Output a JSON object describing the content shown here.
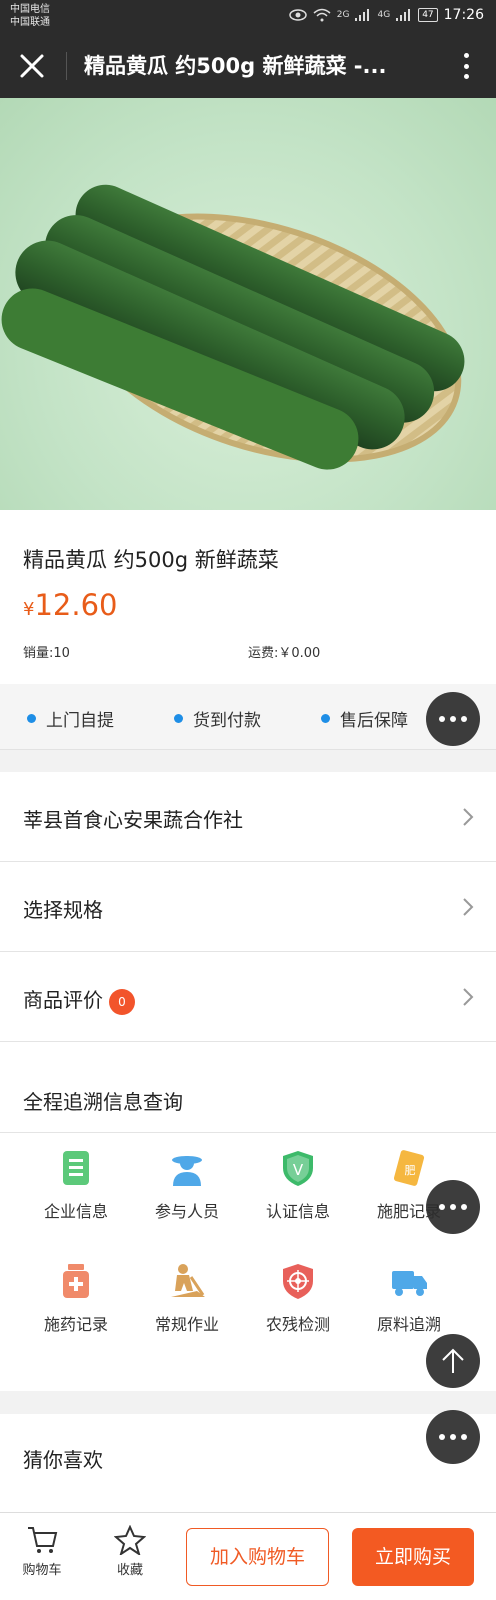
{
  "status_bar": {
    "carrier_1": "中国电信",
    "carrier_2": "中国联通",
    "network_1": "2G",
    "network_2": "4G",
    "battery": "47",
    "time": "17:26"
  },
  "nav": {
    "title": "精品黄瓜 约500g 新鲜蔬菜 -..."
  },
  "product": {
    "name": "精品黄瓜 约500g 新鲜蔬菜",
    "currency": "¥",
    "price": "12.60",
    "sales": "销量:10",
    "freight": "运费:￥0.00"
  },
  "features": [
    "上门自提",
    "货到付款",
    "售后保障"
  ],
  "rows": {
    "shop": "莘县首食心安果蔬合作社",
    "spec": "选择规格",
    "reviews": "商品评价",
    "review_count": "0"
  },
  "trace": {
    "title": "全程追溯信息查询",
    "items": [
      "企业信息",
      "参与人员",
      "认证信息",
      "施肥记录",
      "施药记录",
      "常规作业",
      "农残检测",
      "原料追溯"
    ]
  },
  "guess": {
    "title": "猜你喜欢"
  },
  "bottom_bar": {
    "cart": "购物车",
    "favorite": "收藏",
    "add_to_cart": "加入购物车",
    "buy_now": "立即购买"
  },
  "colors": {
    "price": "#e85c19",
    "accent": "#f35a22",
    "feature_dot": "#1e8ee6",
    "nav_bg": "#2c2c2c"
  }
}
